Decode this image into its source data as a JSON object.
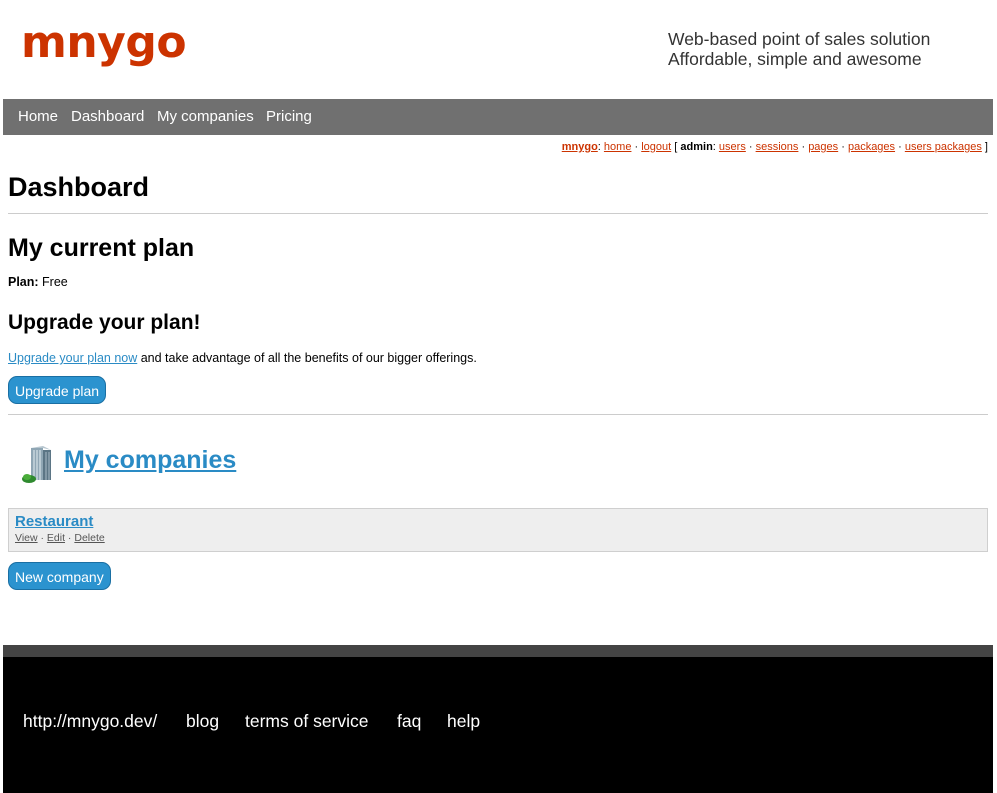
{
  "header": {
    "logo": "mnygo",
    "tagline_line1": "Web-based point of sales solution",
    "tagline_line2": "Affordable, simple and awesome"
  },
  "nav": {
    "items": [
      "Home",
      "Dashboard",
      "My companies",
      "Pricing"
    ]
  },
  "adminbar": {
    "brand": "mnygo",
    "home": "home",
    "logout": "logout",
    "admin_label": "admin",
    "users": "users",
    "sessions": "sessions",
    "pages": "pages",
    "packages": "packages",
    "users_packages": "users packages"
  },
  "main": {
    "page_title": "Dashboard",
    "current_plan_heading": "My current plan",
    "plan_label": "Plan:",
    "plan_value": "Free",
    "upgrade_heading": "Upgrade your plan!",
    "upgrade_link": "Upgrade your plan now",
    "upgrade_text": " and take advantage of all the benefits of our bigger offerings.",
    "upgrade_button": "Upgrade plan"
  },
  "companies": {
    "heading": "My companies",
    "items": [
      {
        "name": "Restaurant",
        "view": "View",
        "edit": "Edit",
        "delete": "Delete"
      }
    ],
    "new_button": "New company"
  },
  "footer": {
    "links": [
      "http://mnygo.dev/",
      "blog",
      "terms of service",
      "faq",
      "help"
    ]
  },
  "colors": {
    "brand": "#cc3300",
    "nav_bg": "#707070",
    "link": "#2a8bc5",
    "button": "#2b93cf"
  },
  "icons": {
    "companies": "building-icon"
  }
}
